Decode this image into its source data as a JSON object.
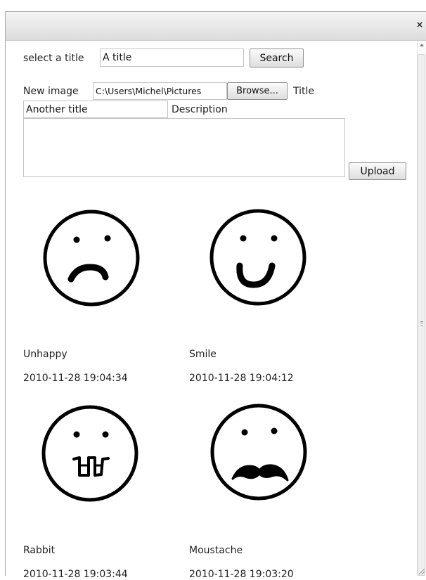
{
  "dialog": {
    "close_icon": "×"
  },
  "search": {
    "label": "select a title",
    "value": "A title",
    "button": "Search"
  },
  "upload": {
    "new_image_label": "New image",
    "file_path": "C:\\Users\\Michel\\Pictures",
    "browse_button": "Browse...",
    "title_label": "Title",
    "title_value": "Another title",
    "description_label": "Description",
    "description_value": "",
    "upload_button": "Upload"
  },
  "gallery": [
    {
      "title": "Unhappy",
      "date": "2010-11-28 19:04:34",
      "face": "frown"
    },
    {
      "title": "Smile",
      "date": "2010-11-28 19:04:12",
      "face": "smile"
    },
    {
      "title": "Rabbit",
      "date": "2010-11-28 19:03:44",
      "face": "rabbit"
    },
    {
      "title": "Moustache",
      "date": "2010-11-28 19:03:20",
      "face": "moustache"
    }
  ]
}
